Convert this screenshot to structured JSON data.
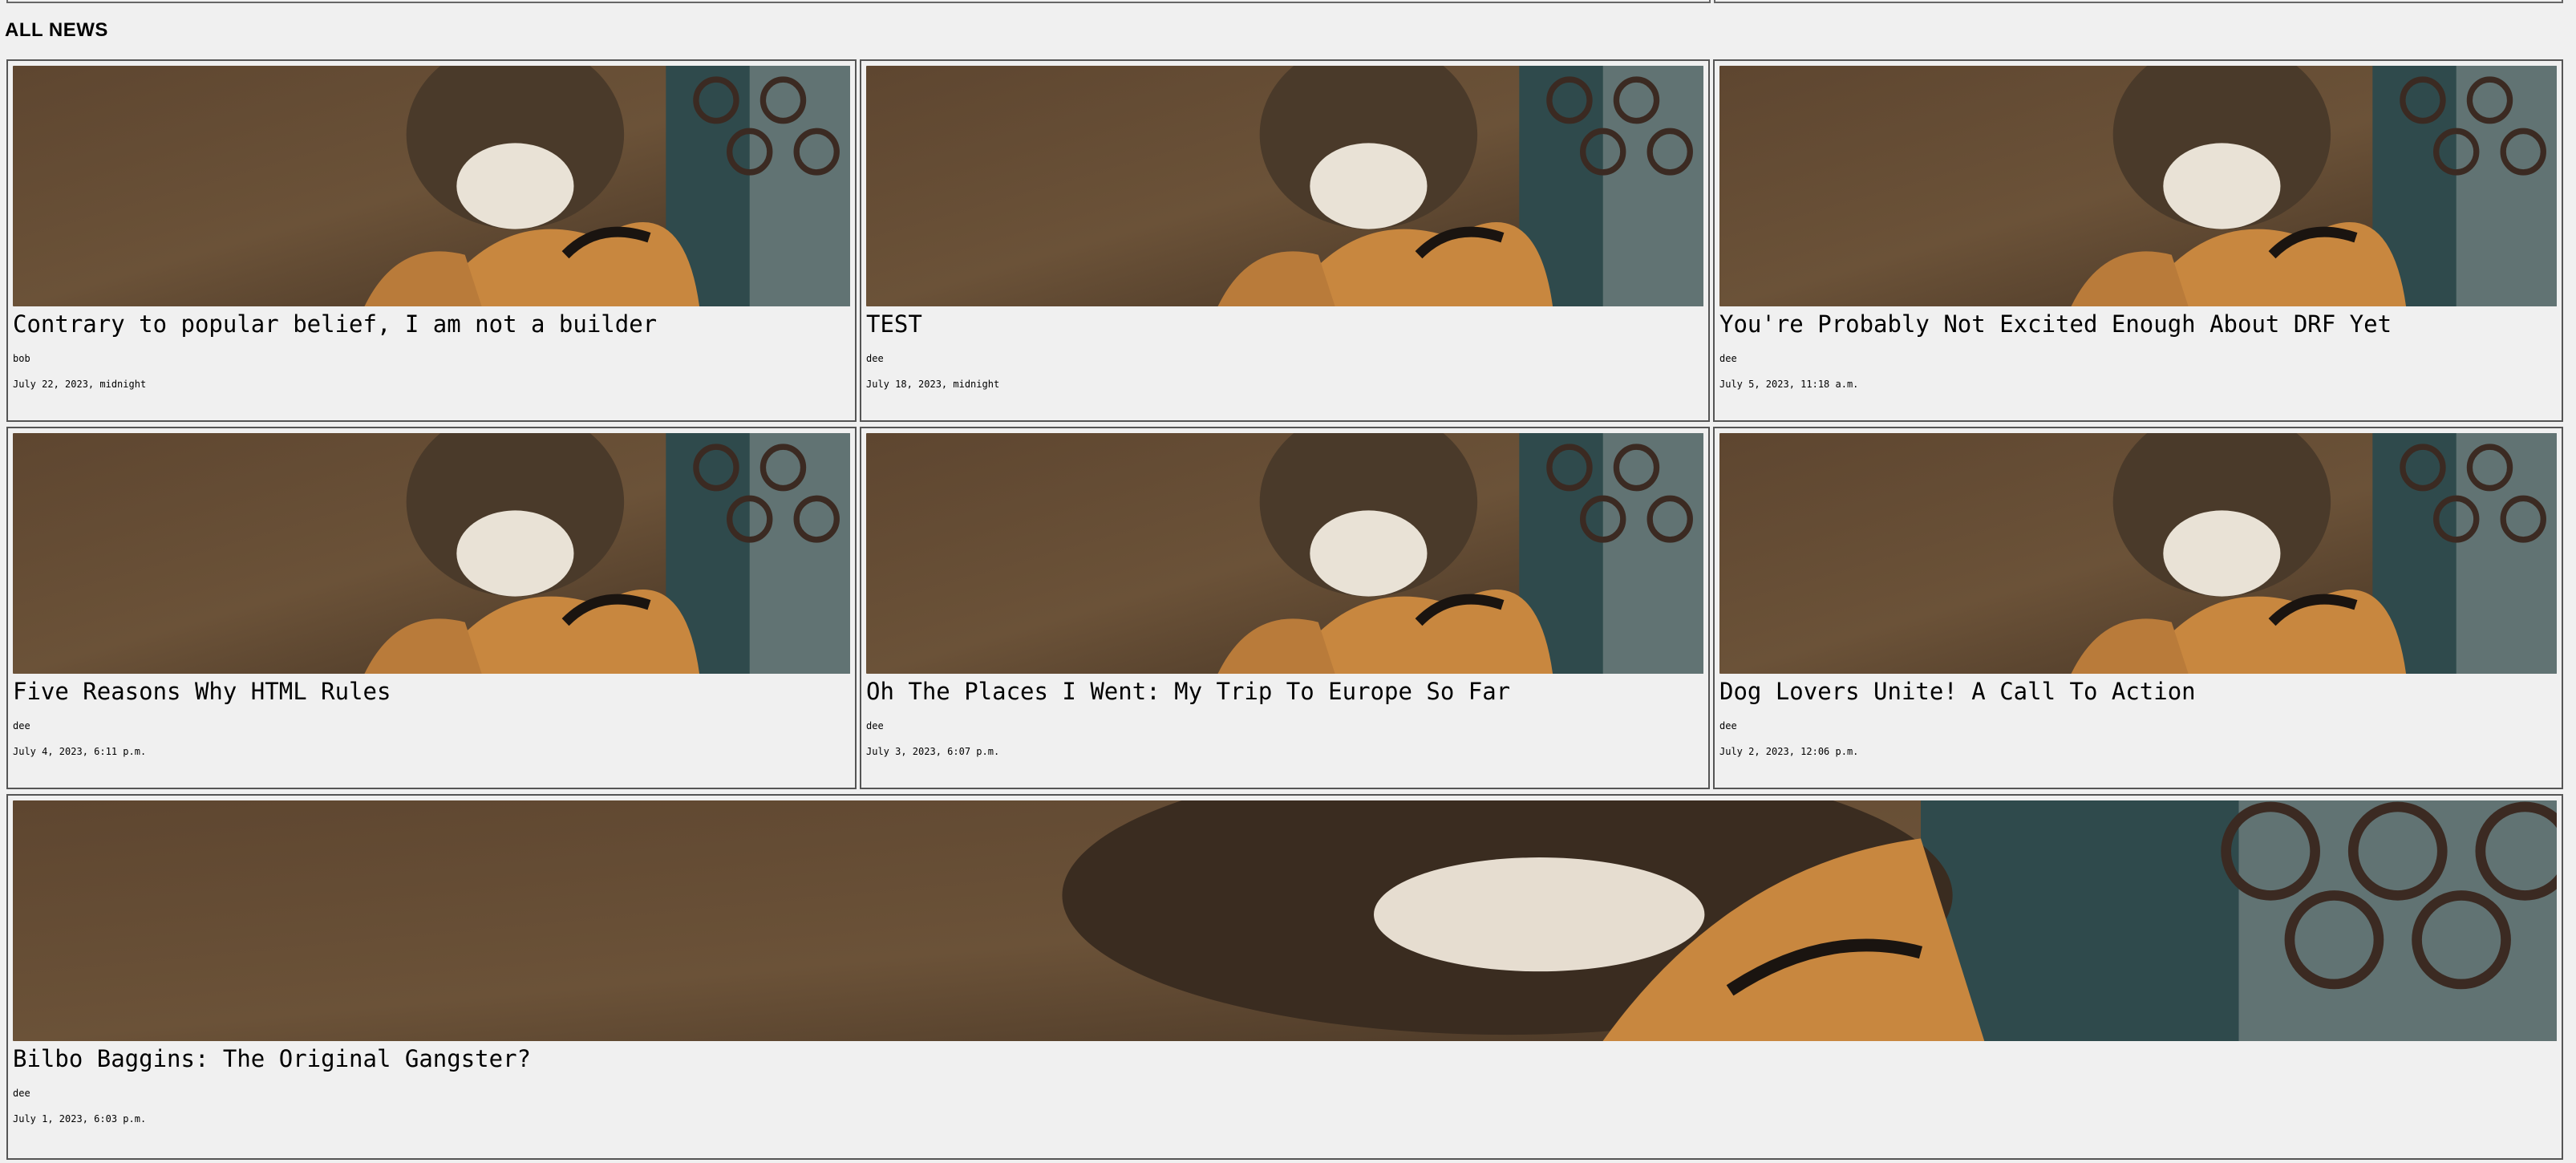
{
  "section": {
    "title": "ALL NEWS"
  },
  "image_icon": "tiger-photo",
  "articles": [
    {
      "title": "Contrary to popular belief, I am not a builder",
      "author": "bob",
      "date": "July 22, 2023, midnight"
    },
    {
      "title": "TEST",
      "author": "dee",
      "date": "July 18, 2023, midnight"
    },
    {
      "title": "You're Probably Not Excited Enough About DRF Yet",
      "author": "dee",
      "date": "July 5, 2023, 11:18 a.m."
    },
    {
      "title": "Five Reasons Why HTML Rules",
      "author": "dee",
      "date": "July 4, 2023, 6:11 p.m."
    },
    {
      "title": "Oh The Places I Went: My Trip To Europe So Far",
      "author": "dee",
      "date": "July 3, 2023, 6:07 p.m."
    },
    {
      "title": "Dog Lovers Unite! A Call To Action",
      "author": "dee",
      "date": "July 2, 2023, 12:06 p.m."
    },
    {
      "title": "Bilbo Baggins: The Original Gangster?",
      "author": "dee",
      "date": "July 1, 2023, 6:03 p.m."
    }
  ],
  "colors": {
    "background": "#f0f0f0",
    "border": "#555555",
    "dirt": "#6b5238",
    "tiger_orange": "#c8873f",
    "fence_teal": "#2f4a4c"
  }
}
